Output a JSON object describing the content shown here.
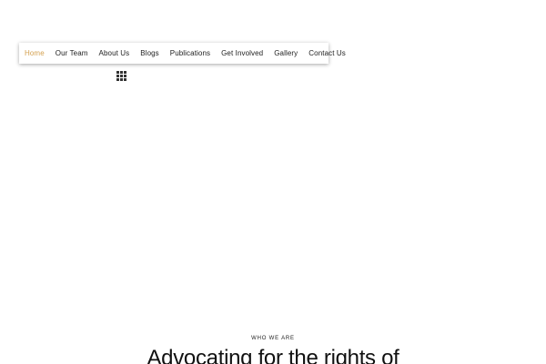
{
  "nav": {
    "items": [
      {
        "label": "Home",
        "active": true
      },
      {
        "label": "Our Team",
        "active": false
      },
      {
        "label": "About Us",
        "active": false
      },
      {
        "label": "Blogs",
        "active": false
      },
      {
        "label": "Publications",
        "active": false
      },
      {
        "label": "Get Involved",
        "active": false
      },
      {
        "label": "Gallery",
        "active": false
      },
      {
        "label": "Contact Us",
        "active": false
      }
    ],
    "active_color": "#d4a050",
    "menu_icon": "grid-menu-icon"
  },
  "hero": {
    "eyebrow": "WHO WE ARE",
    "heading": "Advocating for the rights of"
  }
}
